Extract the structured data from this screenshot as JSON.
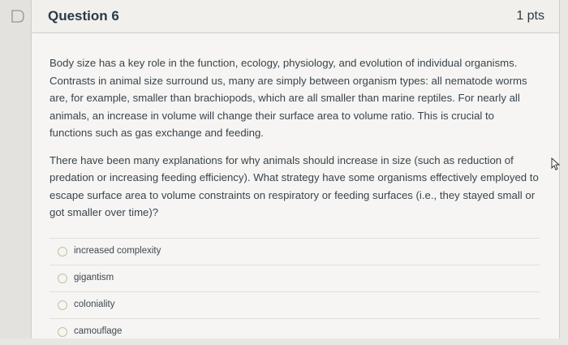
{
  "question": {
    "title": "Question 6",
    "points": "1 pts",
    "paragraphs": [
      "Body size has a key role in the function, ecology, physiology, and evolution of individual organisms. Contrasts in animal size surround us, many are simply between organism types: all nematode worms are, for example, smaller than brachiopods, which are all smaller than marine reptiles. For nearly all animals, an increase in volume will change their surface area to volume ratio. This is crucial to functions such as gas exchange and feeding.",
      "There have been many explanations for why animals should increase in size (such as reduction of predation or increasing feeding efficiency). What strategy have some organisms effectively employed to escape surface area to volume constraints on respiratory or feeding surfaces (i.e., they stayed small or got smaller over time)?"
    ],
    "answers": [
      {
        "label": "increased complexity"
      },
      {
        "label": "gigantism"
      },
      {
        "label": "coloniality"
      },
      {
        "label": "camouflage"
      }
    ]
  },
  "icons": {
    "flag": "flag-icon",
    "cursor": "mouse-pointer-icon"
  },
  "colors": {
    "page_bg": "#e9e7e4",
    "card_bg": "#f6f5f3",
    "header_bg": "#f1f0ed",
    "text": "#2d3b45",
    "radio_border": "#b9c4a8"
  }
}
